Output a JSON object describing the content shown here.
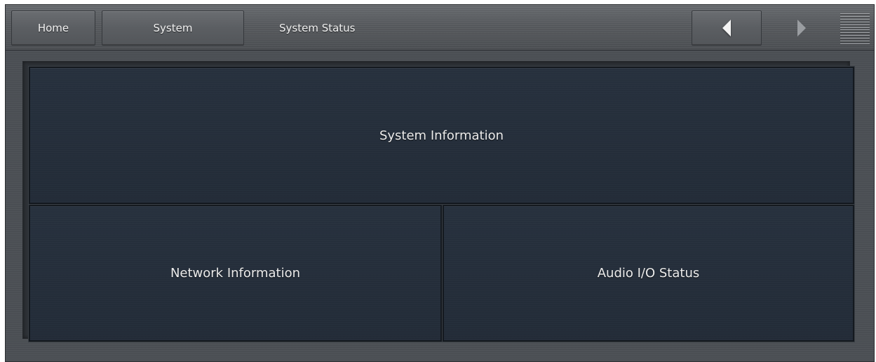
{
  "header": {
    "home_label": "Home",
    "system_label": "System",
    "current_page": "System Status",
    "prev_icon": "chevron-left-icon",
    "next_icon": "chevron-right-icon",
    "menu_icon": "menu-lines-icon"
  },
  "tiles": {
    "system_information": "System Information",
    "network_information": "Network Information",
    "audio_io_status": "Audio I/O Status"
  },
  "colors": {
    "tile_background": "#232c38",
    "frame": "#4a4e53",
    "text": "#ececec"
  }
}
